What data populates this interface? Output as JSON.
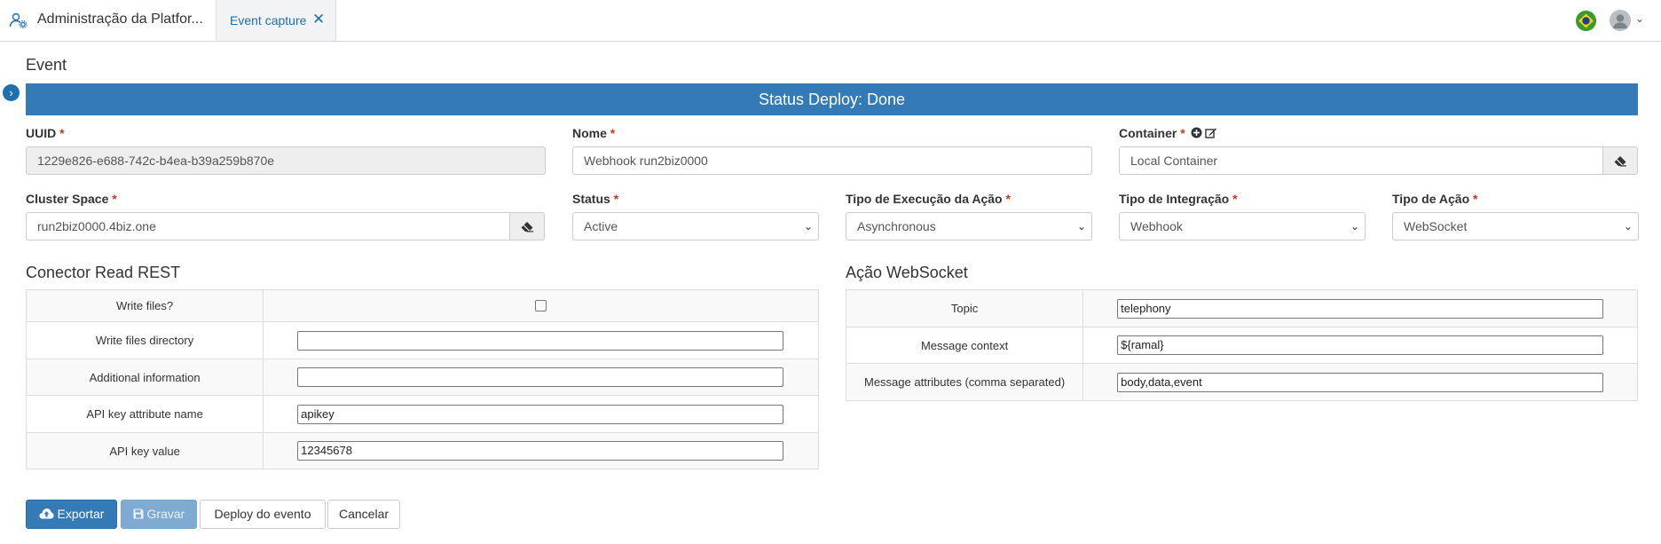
{
  "topbar": {
    "app_title": "Administração da Platfor...",
    "tab_label": "Event capture",
    "tab_close": "✕",
    "user_chevron": "⌄"
  },
  "icons": {
    "app": "users-cog-icon",
    "close": "close-icon",
    "flag": "brazil-flag-icon",
    "avatar": "user-avatar-icon",
    "side_toggle": "chevron-right-icon",
    "eraser": "eraser-icon",
    "add": "plus-circle-icon",
    "edit": "edit-icon",
    "cloud_upload": "cloud-upload-icon",
    "save": "floppy-icon"
  },
  "page": {
    "title": "Event",
    "status": "Status Deploy: Done",
    "side_toggle_glyph": "›"
  },
  "form": {
    "required_mark": "*",
    "uuid": {
      "label": "UUID",
      "value": "1229e826-e688-742c-b4ea-b39a259b870e"
    },
    "nome": {
      "label": "Nome",
      "value": "Webhook run2biz0000"
    },
    "container": {
      "label": "Container",
      "value": "Local Container"
    },
    "cluster_space": {
      "label": "Cluster Space",
      "value": "run2biz0000.4biz.one"
    },
    "status": {
      "label": "Status",
      "value": "Active"
    },
    "tipo_execucao": {
      "label": "Tipo de Execução da Ação",
      "value": "Asynchronous"
    },
    "tipo_integracao": {
      "label": "Tipo de Integração",
      "value": "Webhook"
    },
    "tipo_acao": {
      "label": "Tipo de Ação",
      "value": "WebSocket"
    }
  },
  "connector": {
    "title": "Conector Read REST",
    "rows": [
      {
        "label": "Write files?",
        "value": "",
        "type": "checkbox",
        "checked": false
      },
      {
        "label": "Write files directory",
        "value": "",
        "type": "text"
      },
      {
        "label": "Additional information",
        "value": "",
        "type": "text"
      },
      {
        "label": "API key attribute name",
        "value": "apikey",
        "type": "text"
      },
      {
        "label": "API key value",
        "value": "12345678",
        "type": "text"
      }
    ]
  },
  "websocket": {
    "title": "Ação WebSocket",
    "rows": [
      {
        "label": "Topic",
        "value": "telephony"
      },
      {
        "label": "Message context",
        "value": "${ramal}"
      },
      {
        "label": "Message attributes (comma separated)",
        "value": "body,data,event"
      }
    ]
  },
  "buttons": {
    "exportar": "Exportar",
    "gravar": "Gravar",
    "deploy": "Deploy do evento",
    "cancelar": "Cancelar"
  },
  "colors": {
    "primary": "#337ab7",
    "tab_text": "#1f6fb2",
    "required": "#c0392b"
  }
}
